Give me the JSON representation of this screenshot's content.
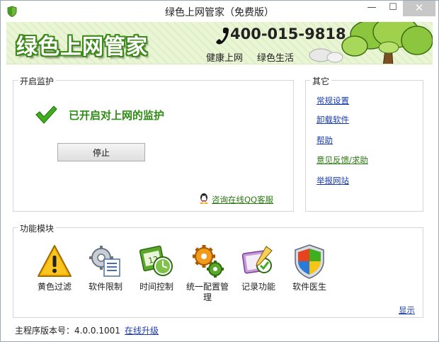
{
  "window": {
    "title": "绿色上网管家（免费版）",
    "minimize_glyph": "—",
    "maximize_glyph": "☐",
    "close_glyph": "✕"
  },
  "banner": {
    "brand": "绿色上网管家",
    "phone": "400-015-9818",
    "slogan_1": "健康上网",
    "slogan_2": "绿色生活"
  },
  "monitor": {
    "group_label": "开启监护",
    "status": "已开启对上网的监护",
    "stop_label": "停止",
    "qq_link": "咨询在线QQ客服"
  },
  "other": {
    "group_label": "其它",
    "links": [
      "常规设置",
      "卸载软件",
      "帮助",
      "意见反馈/求助",
      "举报网站"
    ]
  },
  "modules": {
    "group_label": "功能模块",
    "items": [
      {
        "label": "黄色过滤",
        "icon": "warning-icon"
      },
      {
        "label": "软件限制",
        "icon": "software-limit-icon"
      },
      {
        "label": "时间控制",
        "icon": "time-control-icon"
      },
      {
        "label": "统一配置管理",
        "icon": "config-gears-icon"
      },
      {
        "label": "记录功能",
        "icon": "record-icon"
      },
      {
        "label": "软件医生",
        "icon": "shield-icon"
      }
    ],
    "show_link": "显示"
  },
  "status_bar": {
    "version": "主程序版本号：4.0.0.1001",
    "upgrade": "在线升级"
  },
  "colors": {
    "brand_green": "#3d8a1a",
    "status_green": "#2e8c14",
    "link_blue": "#1a3cb0"
  }
}
